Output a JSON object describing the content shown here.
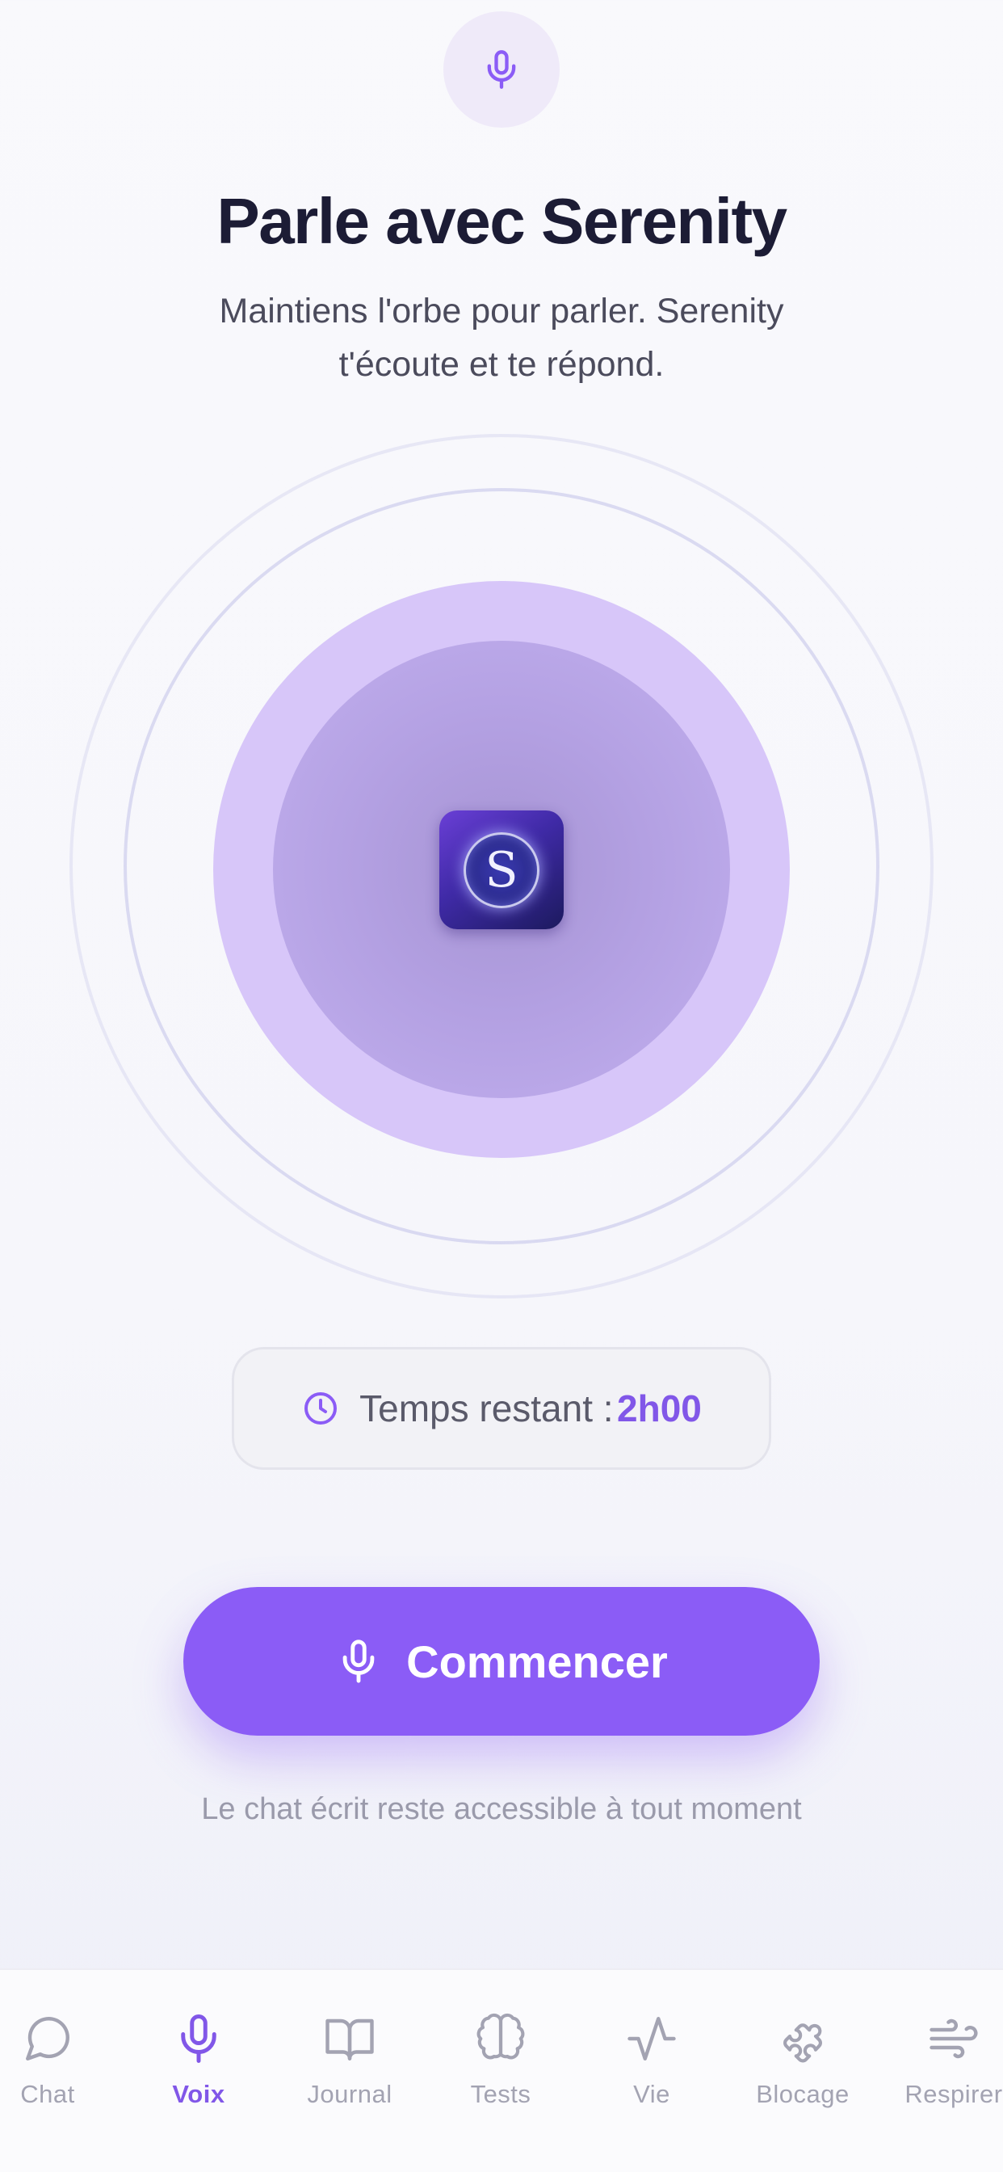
{
  "header": {
    "title": "Parle avec Serenity",
    "subtitle": "Maintiens l'orbe pour parler. Serenity t'écoute et te répond."
  },
  "orb": {
    "logo_letter": "S"
  },
  "timer": {
    "label": "Temps restant :",
    "value": "2h00"
  },
  "start_button": {
    "label": "Commencer"
  },
  "footnote": "Le chat écrit reste accessible à tout moment",
  "colors": {
    "accent": "#8b5cf6",
    "title": "#1c1c35",
    "inactive_nav": "#a3a3b2"
  },
  "nav": {
    "items": [
      {
        "label": "Chat",
        "icon": "chat-bubble-icon",
        "active": false
      },
      {
        "label": "Voix",
        "icon": "microphone-icon",
        "active": true
      },
      {
        "label": "Journal",
        "icon": "book-icon",
        "active": false
      },
      {
        "label": "Tests",
        "icon": "brain-icon",
        "active": false
      },
      {
        "label": "Vie",
        "icon": "activity-icon",
        "active": false
      },
      {
        "label": "Blocage",
        "icon": "puzzle-icon",
        "active": false
      },
      {
        "label": "Respirer",
        "icon": "wind-icon",
        "active": false
      }
    ]
  }
}
